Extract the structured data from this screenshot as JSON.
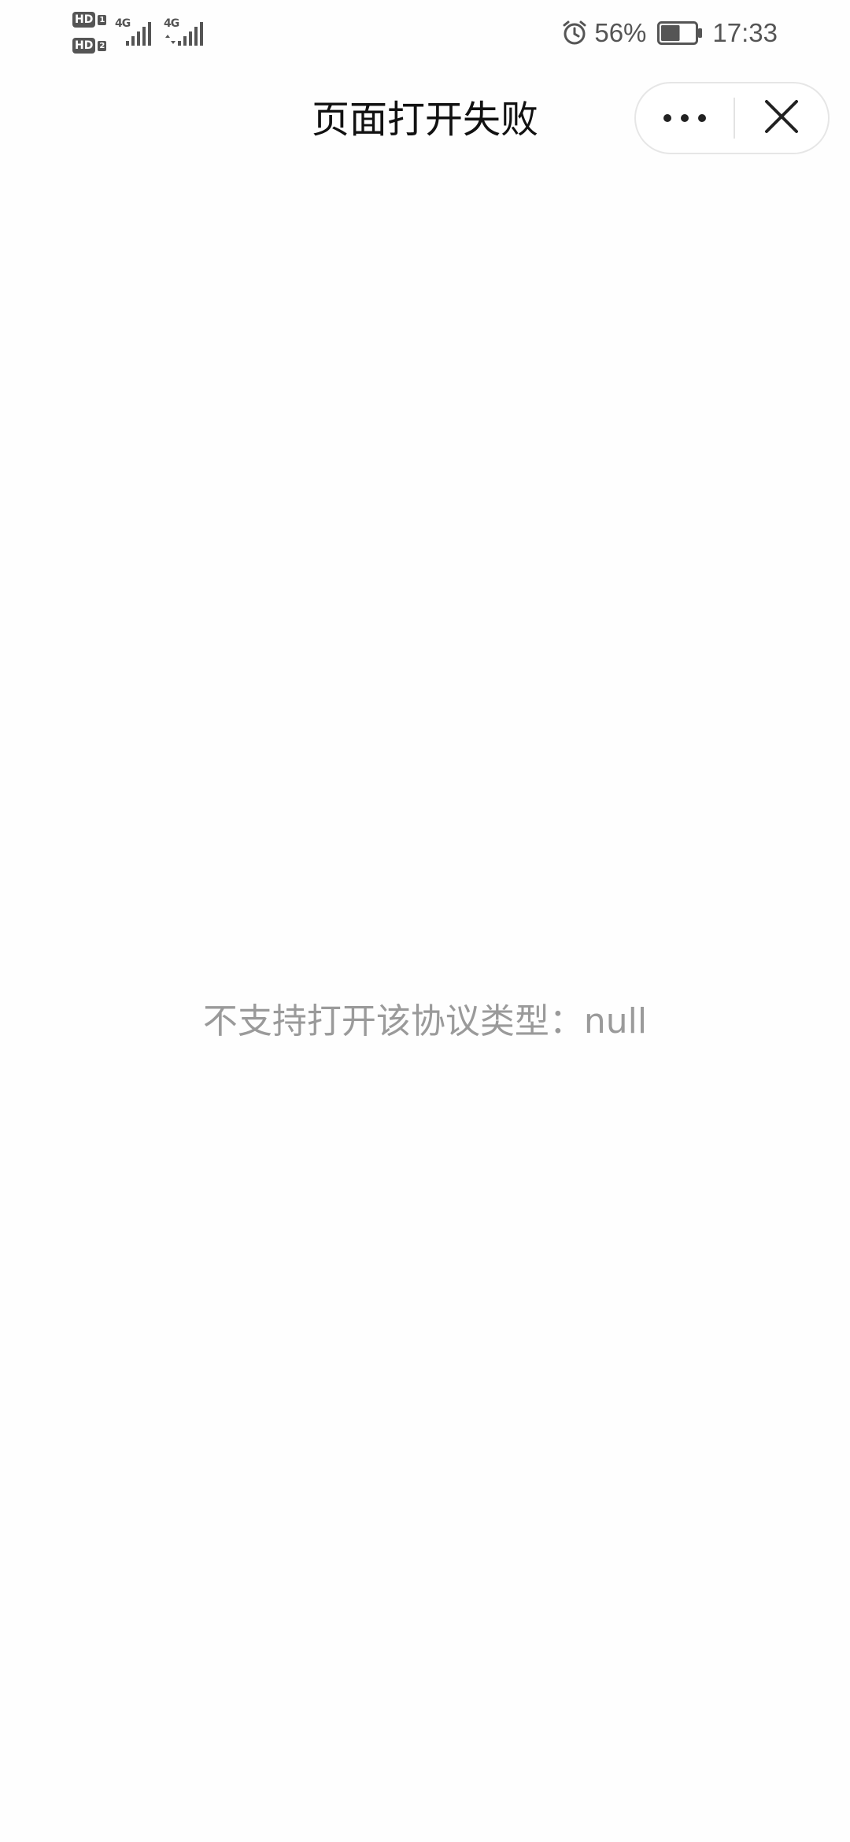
{
  "status_bar": {
    "sim1_badge": "HD",
    "sim1_index": "1",
    "sim2_badge": "HD",
    "sim2_index": "2",
    "sim1_network": "4G",
    "sim2_network": "4G",
    "battery_percent": "56%",
    "battery_level": 0.56,
    "time": "17:33",
    "icons": [
      "alarm-icon",
      "signal-icon",
      "battery-icon"
    ]
  },
  "nav": {
    "title": "页面打开失败",
    "icons": [
      "more-icon",
      "close-icon"
    ]
  },
  "content": {
    "error_message": "不支持打开该协议类型：null"
  },
  "colors": {
    "background": "#fefefe",
    "title": "#111111",
    "message": "#9a9a9a",
    "status": "#555555",
    "capsule_border": "#e6e6e6"
  }
}
